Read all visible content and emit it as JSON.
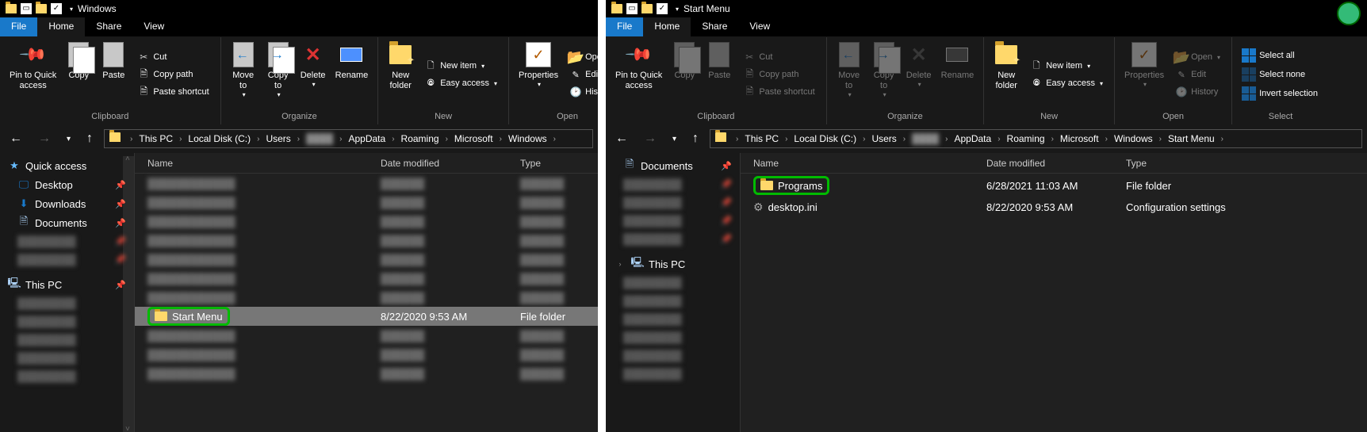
{
  "left": {
    "title": "Windows",
    "tabs": {
      "file": "File",
      "home": "Home",
      "share": "Share",
      "view": "View"
    },
    "ribbon": {
      "clipboard": {
        "label": "Clipboard",
        "pin": "Pin to Quick\naccess",
        "copy": "Copy",
        "paste": "Paste",
        "cut": "Cut",
        "copypath": "Copy path",
        "pshort": "Paste shortcut"
      },
      "organize": {
        "label": "Organize",
        "moveto": "Move\nto",
        "copyto": "Copy\nto",
        "delete": "Delete",
        "rename": "Rename"
      },
      "new": {
        "label": "New",
        "newfolder": "New\nfolder",
        "newitem": "New item",
        "easy": "Easy access"
      },
      "open": {
        "label": "Open",
        "props": "Properties",
        "open": "Open",
        "edit": "Edit",
        "history": "History"
      },
      "select": {
        "label": "",
        "selectall": "",
        "selectnone": "",
        "invert": ""
      }
    },
    "breadcrumb": [
      "This PC",
      "Local Disk (C:)",
      "Users",
      "",
      "AppData",
      "Roaming",
      "Microsoft",
      "Windows"
    ],
    "sidebar": {
      "quick": "Quick access",
      "desktop": "Desktop",
      "downloads": "Downloads",
      "documents": "Documents",
      "thispc": "This PC"
    },
    "columns": {
      "name": "Name",
      "date": "Date modified",
      "type": "Type"
    },
    "rows": {
      "startmenu": {
        "name": "Start Menu",
        "date": "8/22/2020  9:53 AM",
        "type": "File folder"
      }
    }
  },
  "right": {
    "title": "Start Menu",
    "tabs": {
      "file": "File",
      "home": "Home",
      "share": "Share",
      "view": "View"
    },
    "ribbon": {
      "clipboard": {
        "label": "Clipboard",
        "pin": "Pin to Quick\naccess",
        "copy": "Copy",
        "paste": "Paste",
        "cut": "Cut",
        "copypath": "Copy path",
        "pshort": "Paste shortcut"
      },
      "organize": {
        "label": "Organize",
        "moveto": "Move\nto",
        "copyto": "Copy\nto",
        "delete": "Delete",
        "rename": "Rename"
      },
      "new": {
        "label": "New",
        "newfolder": "New\nfolder",
        "newitem": "New item",
        "easy": "Easy access"
      },
      "open": {
        "label": "Open",
        "props": "Properties",
        "open": "Open",
        "edit": "Edit",
        "history": "History"
      },
      "select": {
        "label": "Select",
        "selectall": "Select all",
        "selectnone": "Select none",
        "invert": "Invert selection"
      }
    },
    "breadcrumb": [
      "This PC",
      "Local Disk (C:)",
      "Users",
      "",
      "AppData",
      "Roaming",
      "Microsoft",
      "Windows",
      "Start Menu"
    ],
    "sidebar": {
      "documents": "Documents",
      "thispc": "This PC"
    },
    "columns": {
      "name": "Name",
      "date": "Date modified",
      "type": "Type"
    },
    "rows": {
      "programs": {
        "name": "Programs",
        "date": "6/28/2021  11:03 AM",
        "type": "File folder"
      },
      "desktopini": {
        "name": "desktop.ini",
        "date": "8/22/2020  9:53 AM",
        "type": "Configuration settings"
      }
    }
  }
}
